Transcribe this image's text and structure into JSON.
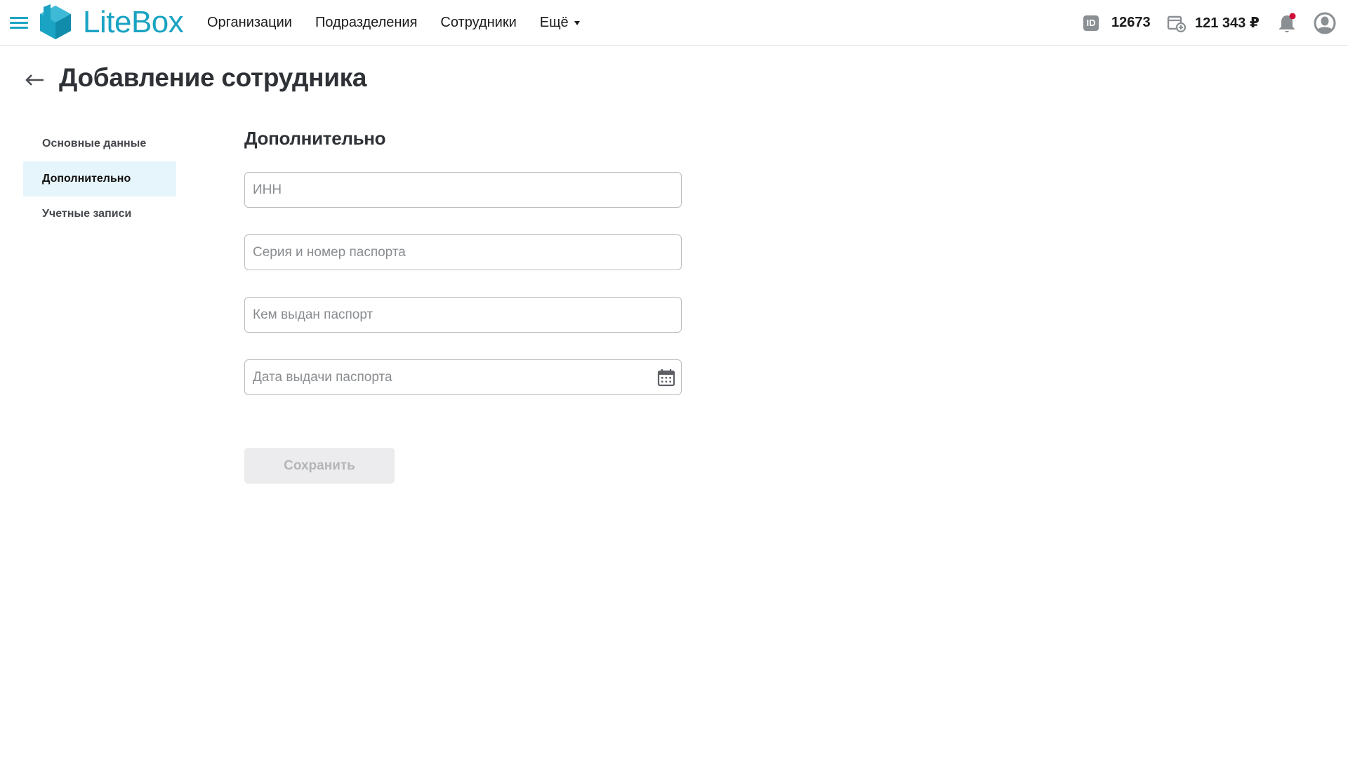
{
  "header": {
    "logo_text": "LiteBox",
    "nav": [
      {
        "label": "Организации"
      },
      {
        "label": "Подразделения"
      },
      {
        "label": "Сотрудники"
      },
      {
        "label": "Ещё"
      }
    ],
    "account_id_badge": "ID",
    "account_id": "12673",
    "balance": "121 343 ₽",
    "notification_dot_color": "#d0103a"
  },
  "page": {
    "title": "Добавление сотрудника"
  },
  "sidebar": {
    "items": [
      {
        "label": "Основные данные",
        "active": false
      },
      {
        "label": "Дополнительно",
        "active": true
      },
      {
        "label": "Учетные записи",
        "active": false
      }
    ]
  },
  "form": {
    "section_title": "Дополнительно",
    "fields": [
      {
        "value": "",
        "placeholder": "ИНН"
      },
      {
        "value": "",
        "placeholder": "Серия и номер паспорта"
      },
      {
        "value": "",
        "placeholder": "Кем выдан паспорт"
      },
      {
        "value": "",
        "placeholder": "Дата выдачи паспорта",
        "icon": "calendar-icon"
      }
    ],
    "save_label": "Сохранить",
    "save_disabled": true
  },
  "colors": {
    "accent": "#1aa3c3",
    "active_menu_bg": "#e6f5fb",
    "disabled_button_bg": "#ececee"
  }
}
